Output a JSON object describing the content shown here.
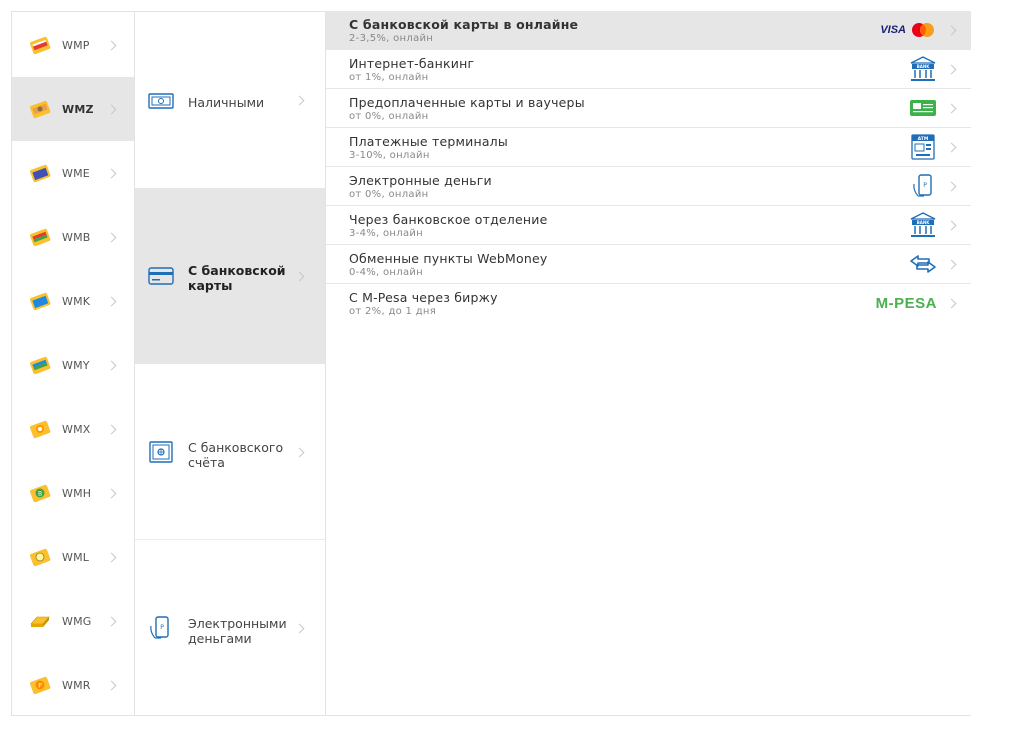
{
  "currencies": [
    {
      "code": "WMP",
      "icon": "wallet-wmp-icon",
      "color": "#e53935",
      "selected": false
    },
    {
      "code": "WMZ",
      "icon": "wallet-wmz-icon",
      "color": "#43a047",
      "selected": true
    },
    {
      "code": "WME",
      "icon": "wallet-wme-icon",
      "color": "#3f51b5",
      "selected": false
    },
    {
      "code": "WMB",
      "icon": "wallet-wmb-icon",
      "color": "#e53935",
      "selected": false
    },
    {
      "code": "WMK",
      "icon": "wallet-wmk-icon",
      "color": "#1e88e5",
      "selected": false
    },
    {
      "code": "WMY",
      "icon": "wallet-wmy-icon",
      "color": "#1e88e5",
      "selected": false
    },
    {
      "code": "WMX",
      "icon": "wallet-wmx-icon",
      "color": "#ff9800",
      "selected": false
    },
    {
      "code": "WMH",
      "icon": "wallet-wmh-icon",
      "color": "#43a047",
      "selected": false
    },
    {
      "code": "WML",
      "icon": "wallet-wml-icon",
      "color": "#fbc02d",
      "selected": false
    },
    {
      "code": "WMG",
      "icon": "gold-bar-icon",
      "color": "#fbc02d",
      "selected": false
    },
    {
      "code": "WMR",
      "icon": "wallet-wmr-icon",
      "color": "#fb8c00",
      "selected": false
    }
  ],
  "methods": [
    {
      "label": "Наличными",
      "icon": "cash-icon",
      "selected": false
    },
    {
      "label": "С банковской карты",
      "icon": "bank-card-icon",
      "selected": true
    },
    {
      "label": "С банковского счёта",
      "icon": "bank-safe-icon",
      "selected": false
    },
    {
      "label": "Электронными деньгами",
      "icon": "e-money-icon",
      "selected": false
    }
  ],
  "options": [
    {
      "title": "С банковской карты в онлайне",
      "sub": "2-3,5%, онлайн",
      "icon": "visa-mastercard-logo",
      "visa_text": "VISA",
      "selected": true
    },
    {
      "title": "Интернет-банкинг",
      "sub": "от 1%, онлайн",
      "icon": "bank-icon",
      "selected": false
    },
    {
      "title": "Предоплаченные карты и ваучеры",
      "sub": "от 0%, онлайн",
      "icon": "voucher-card-icon",
      "selected": false
    },
    {
      "title": "Платежные терминалы",
      "sub": "3-10%, онлайн",
      "icon": "atm-icon",
      "selected": false
    },
    {
      "title": "Электронные деньги",
      "sub": "от 0%, онлайн",
      "icon": "e-money-icon",
      "selected": false
    },
    {
      "title": "Через банковское отделение",
      "sub": "3-4%, онлайн",
      "icon": "bank-icon",
      "selected": false
    },
    {
      "title": "Обменные пункты WebMoney",
      "sub": "0-4%, онлайн",
      "icon": "exchange-arrows-icon",
      "selected": false
    },
    {
      "title": "С M-Pesa через биржу",
      "sub": "от 2%, до 1 дня",
      "icon": "mpesa-logo",
      "mpesa_text": "M-PESA",
      "selected": false
    }
  ],
  "colors": {
    "selected_bg": "#e6e6e6",
    "icon_blue": "#1f6eb7",
    "border": "#e3e3e3"
  }
}
